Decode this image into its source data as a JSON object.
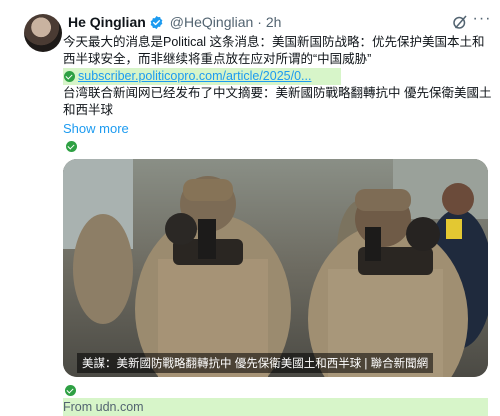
{
  "author": {
    "name": "He Qinglian",
    "handle": "@HeQinglian",
    "time": "· 2h"
  },
  "tweet": {
    "line1": "今天最大的消息是Political 这条消息：美国新国防战略：优先保护美国本土和",
    "line2": "西半球安全，而非继续将重点放在应对所谓的“中国威胁”",
    "link": "subscriber.politicopro.com/article/2025/0...",
    "line3": "台湾联合新闻网已经发布了中文摘要：美新國防戰略翻轉抗中 優先保衛美國土",
    "line4": "和西半球",
    "show_more": "Show more"
  },
  "card": {
    "caption": "美謀：美新國防戰略翻轉抗中 優先保衛美國土和西半球 | 聯合新聞網",
    "from": "From udn.com"
  },
  "colors": {
    "link": "#1d9bf0",
    "highlight": "#d7f5c9",
    "check": "#2ea043",
    "verified": "#1d9bf0"
  },
  "icons": [
    "verified-badge-icon",
    "grok-icon",
    "more-icon",
    "check-icon"
  ]
}
